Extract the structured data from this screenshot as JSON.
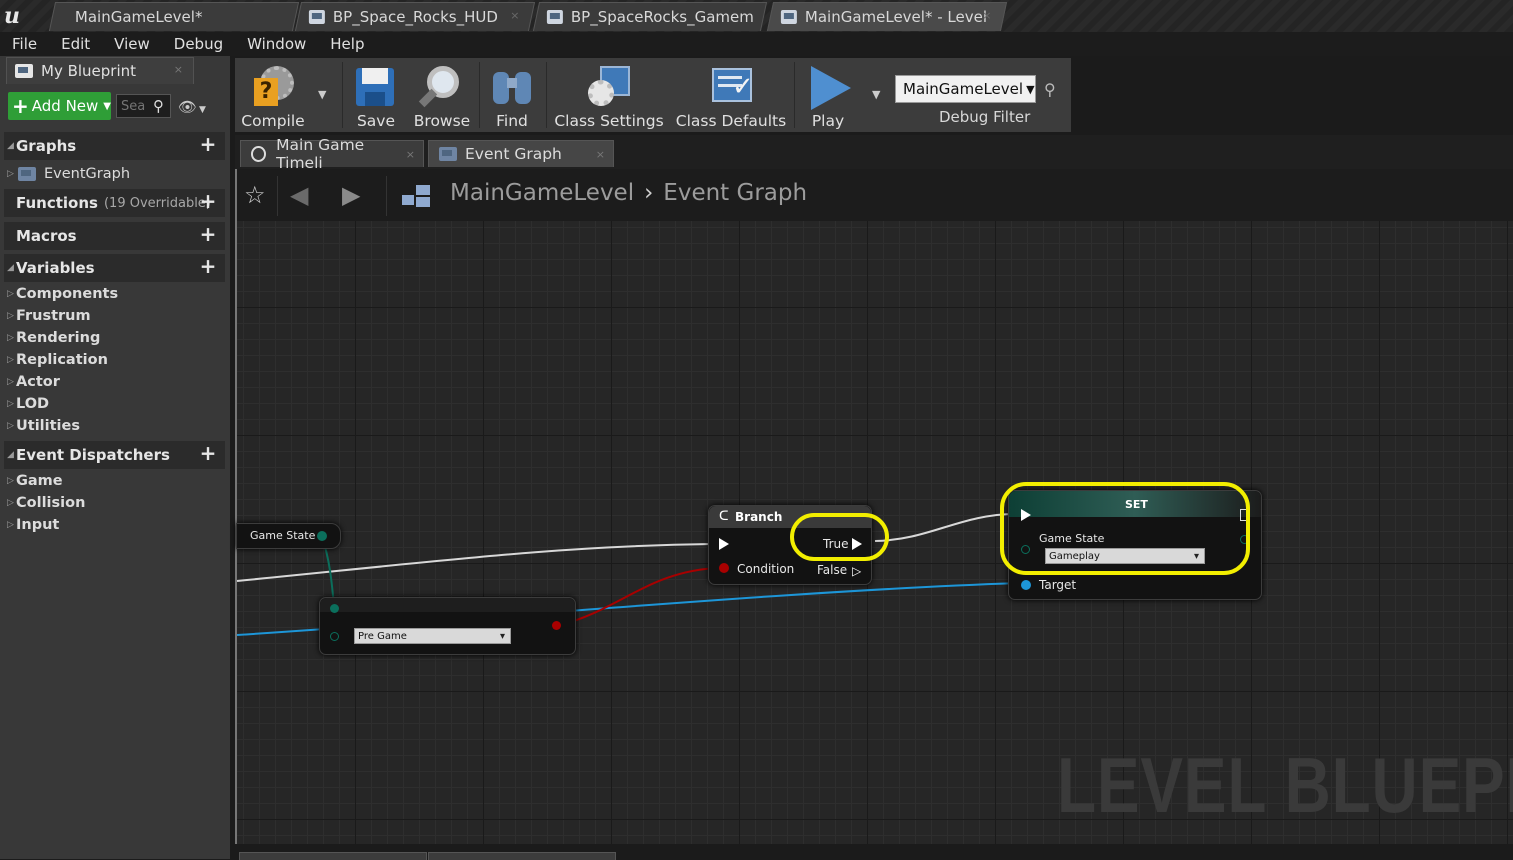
{
  "window_tabs": [
    {
      "label": "MainGameLevel*"
    },
    {
      "label": "BP_Space_Rocks_HUD"
    },
    {
      "label": "BP_SpaceRocks_Gamem"
    },
    {
      "label": "MainGameLevel* - Level"
    }
  ],
  "menu": [
    "File",
    "Edit",
    "View",
    "Debug",
    "Window",
    "Help"
  ],
  "left_panel": {
    "tab_label": "My Blueprint",
    "add_new_label": "Add New",
    "search_placeholder": "Sea",
    "graphs": {
      "title": "Graphs",
      "items": [
        "EventGraph"
      ]
    },
    "functions": {
      "title": "Functions",
      "count_label": "(19 Overridable)"
    },
    "macros": {
      "title": "Macros"
    },
    "variables": {
      "title": "Variables",
      "items": [
        "Components",
        "Frustrum",
        "Rendering",
        "Replication",
        "Actor",
        "LOD",
        "Utilities"
      ]
    },
    "event_dispatchers": {
      "title": "Event Dispatchers",
      "items": [
        "Game",
        "Collision",
        "Input"
      ]
    }
  },
  "toolbar": {
    "compile": "Compile",
    "save": "Save",
    "browse": "Browse",
    "find": "Find",
    "class_settings": "Class Settings",
    "class_defaults": "Class Defaults",
    "play": "Play",
    "debug_object": "MainGameLevel",
    "debug_filter": "Debug Filter"
  },
  "graph_tabs": [
    "Main Game Timeli",
    "Event Graph"
  ],
  "breadcrumb": {
    "level": "MainGameLevel",
    "graph": "Event Graph"
  },
  "watermark": "LEVEL BLUEPR",
  "nodes": {
    "game_state_getter": {
      "label": "Game State"
    },
    "compare": {
      "value": "Pre Game"
    },
    "branch": {
      "title": "Branch",
      "true_label": "True",
      "condition_label": "Condition",
      "false_label": "False"
    },
    "set": {
      "title": "SET",
      "var_label": "Game State",
      "value": "Gameplay",
      "target_label": "Target"
    }
  },
  "colors": {
    "highlight": "#f2ee00",
    "exec_wire": "#d8d8d8",
    "object_wire": "#1d96d8",
    "bool_wire": "#a80000",
    "enum_pin": "#0b6f5c"
  }
}
